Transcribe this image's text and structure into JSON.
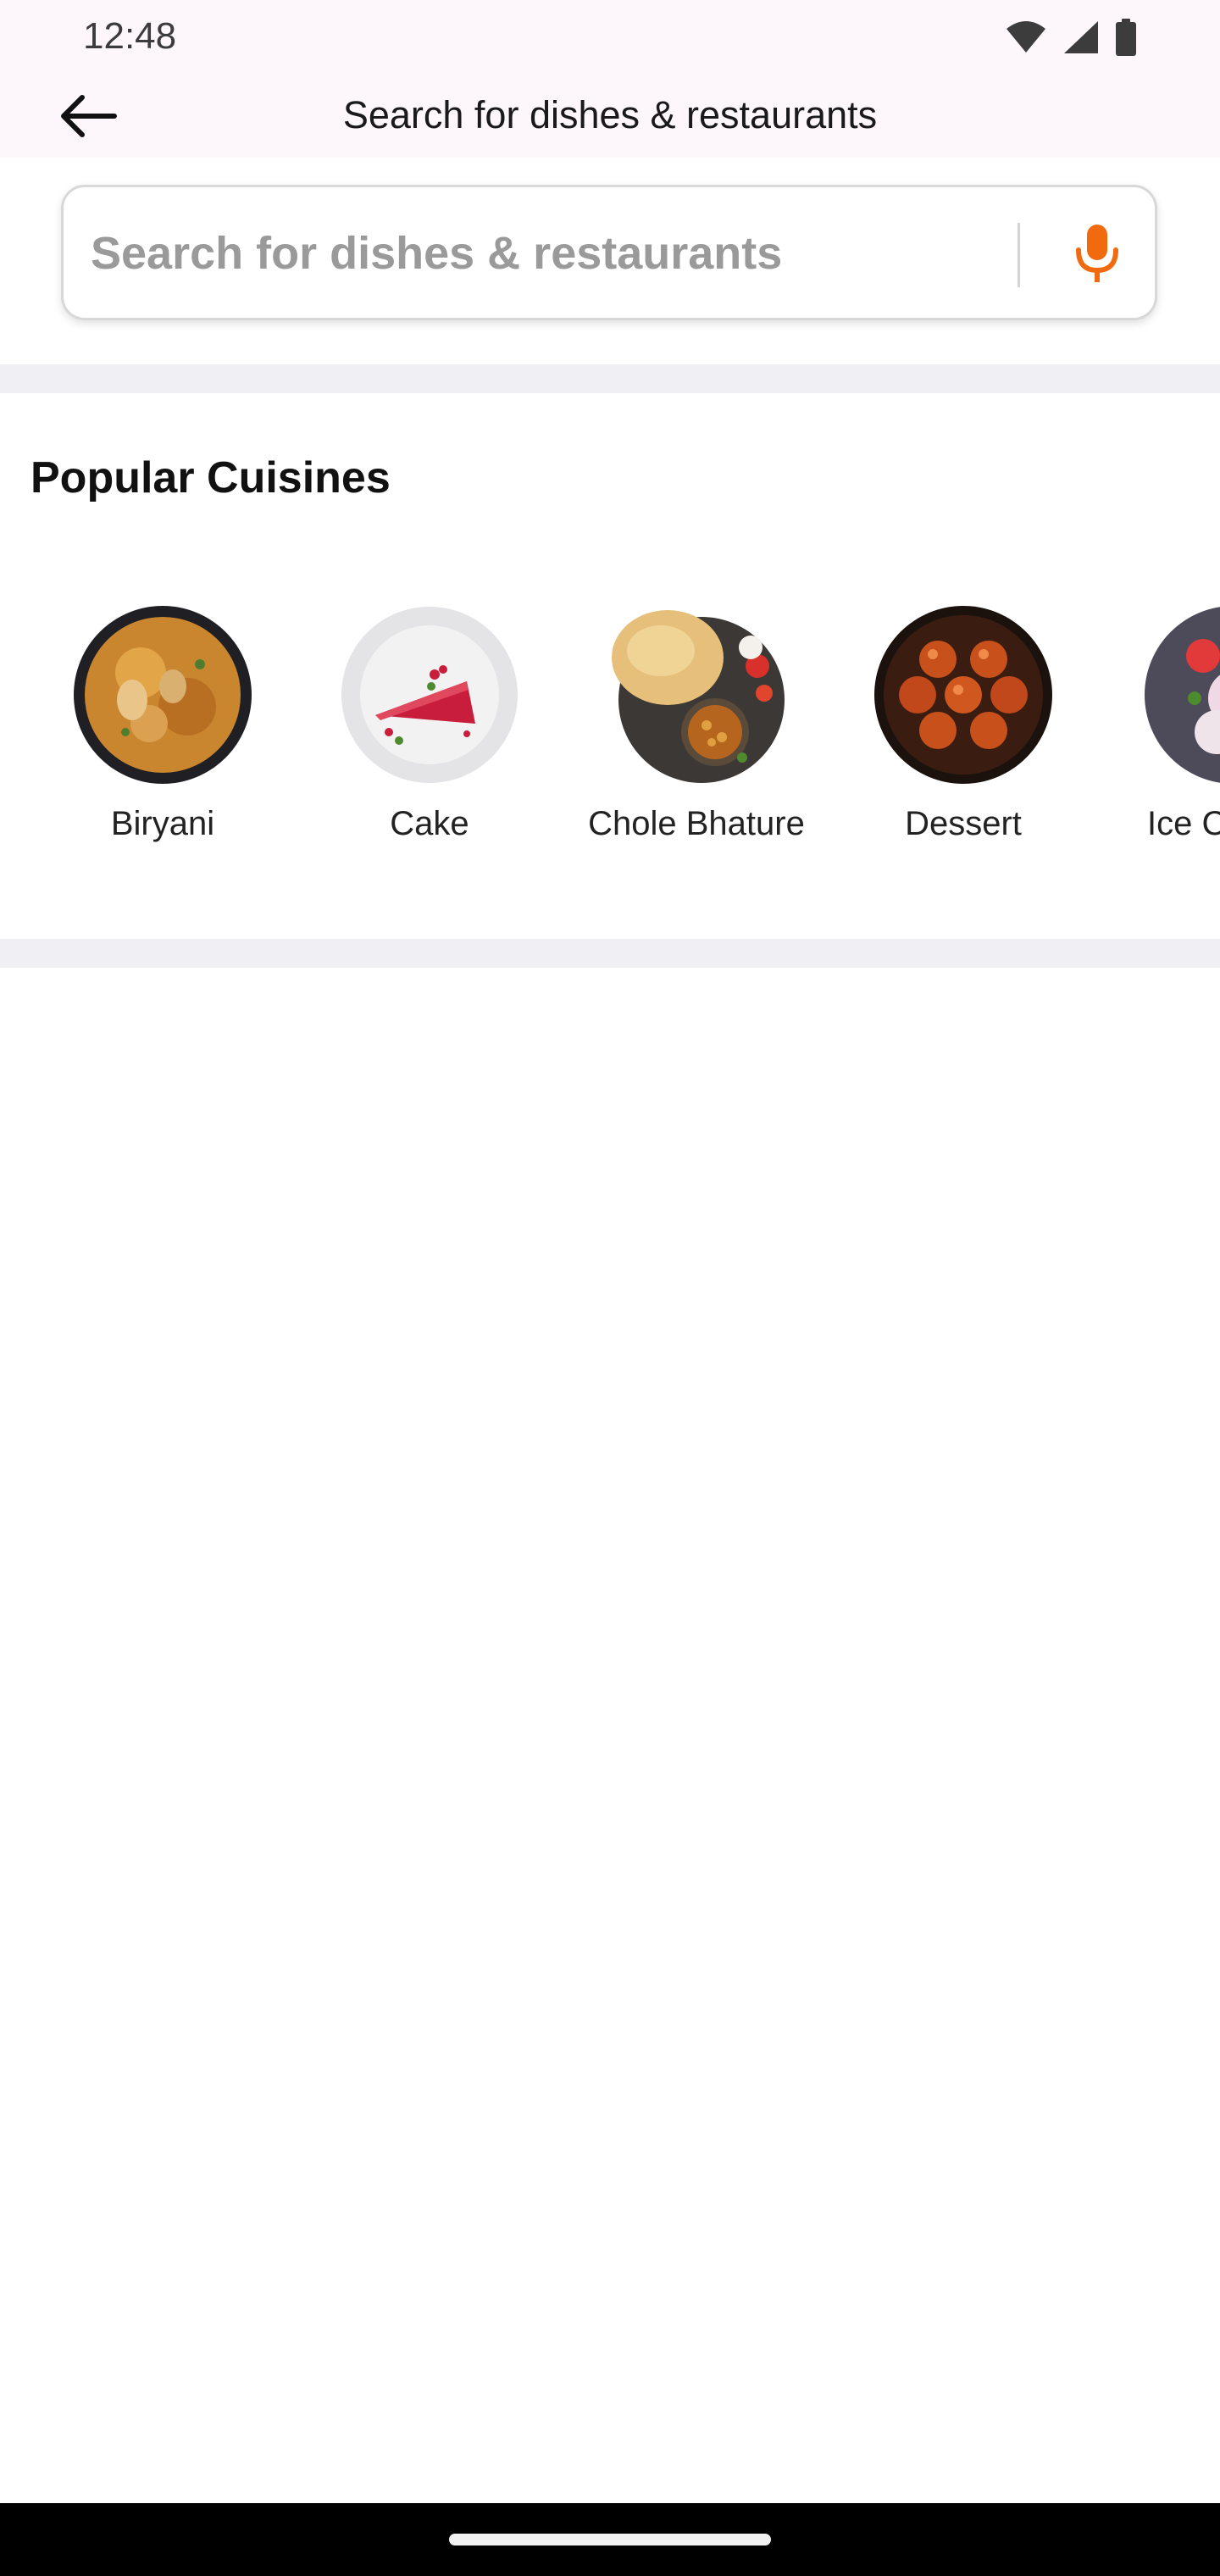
{
  "status_bar": {
    "time": "12:48",
    "icons": [
      "wifi-icon",
      "signal-icon",
      "battery-icon"
    ]
  },
  "header": {
    "title": "Search for dishes & restaurants",
    "back_icon": "arrow-left-icon"
  },
  "search": {
    "placeholder": "Search for dishes & restaurants",
    "value": "",
    "mic_icon": "microphone-icon",
    "accent_color": "#f26a10"
  },
  "popular_cuisines": {
    "title": "Popular Cuisines",
    "items": [
      {
        "label": "Biryani",
        "icon": "biryani-image"
      },
      {
        "label": "Cake",
        "icon": "cake-image"
      },
      {
        "label": "Chole Bhature",
        "icon": "chole-bhature-image"
      },
      {
        "label": "Dessert",
        "icon": "dessert-image"
      },
      {
        "label": "Ice C",
        "icon": "ice-cream-image"
      }
    ]
  }
}
